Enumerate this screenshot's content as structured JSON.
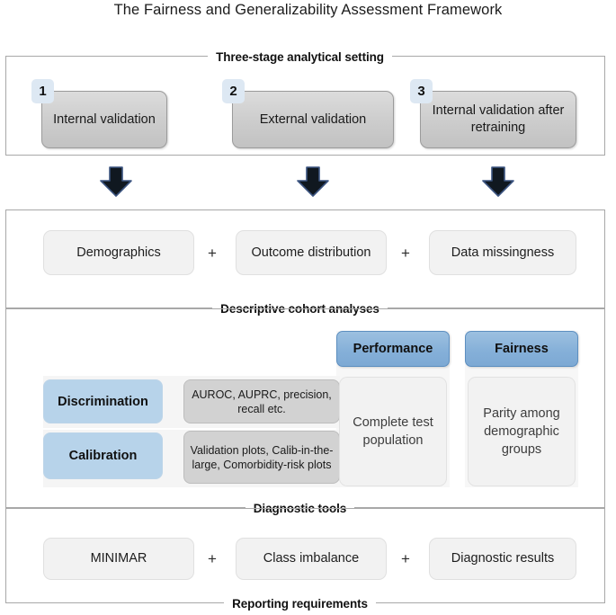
{
  "figure": {
    "title": "The Fairness and Generalizability Assessment Framework"
  },
  "sections": {
    "stage_caption": "Three-stage analytical setting",
    "descriptive_caption": "Descriptive cohort analyses",
    "diagnostic_caption": "Diagnostic tools",
    "reporting_caption": "Reporting requirements"
  },
  "stages": [
    {
      "number": "1",
      "label": "Internal validation"
    },
    {
      "number": "2",
      "label": "External validation"
    },
    {
      "number": "3",
      "label": "Internal validation after retraining"
    }
  ],
  "arrows": [
    {
      "name": "arrow-stage-1"
    },
    {
      "name": "arrow-stage-2"
    },
    {
      "name": "arrow-stage-3"
    }
  ],
  "descriptive": {
    "items": [
      {
        "label": "Demographics"
      },
      {
        "label": "Outcome distribution"
      },
      {
        "label": "Data missingness"
      }
    ],
    "separators": [
      "+",
      "+"
    ]
  },
  "diagnostic": {
    "column_headers": [
      {
        "label": "Performance"
      },
      {
        "label": "Fairness"
      }
    ],
    "categories": [
      {
        "label": "Discrimination",
        "detail": "AUROC, AUPRC, precision, recall etc."
      },
      {
        "label": "Calibration",
        "detail": "Validation plots, Calib-in-the-large, Comorbidity-risk plots"
      }
    ],
    "outcomes": [
      {
        "label": "Complete test population"
      },
      {
        "label": "Parity among demographic groups"
      }
    ]
  },
  "reporting": {
    "items": [
      {
        "label": "MINIMAR"
      },
      {
        "label": "Class imbalance"
      },
      {
        "label": "Diagnostic results"
      }
    ],
    "separators": [
      "+",
      "+"
    ]
  },
  "colors": {
    "blue_header": "#84afd8",
    "blue_category": "#b7d3ea",
    "badge": "#dde8f3",
    "stage_grey": "#cccccc",
    "detail_grey": "#d2d2d2",
    "pill_grey": "#f2f2f2",
    "border": "#a8a8a8",
    "arrow_fill": "#101820",
    "arrow_stroke": "#3b5480"
  }
}
